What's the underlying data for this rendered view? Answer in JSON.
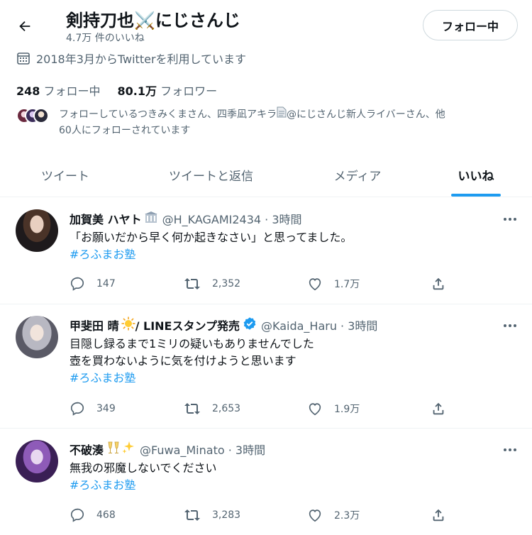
{
  "header": {
    "title": "剣持刀也⚔️にじさんじ",
    "likes_count": "4.7万 件のいいね",
    "follow_button": "フォロー中"
  },
  "profile": {
    "joined": "2018年3月からTwitterを利用しています",
    "following_count": "248",
    "following_label": "フォロー中",
    "followers_count": "80.1万",
    "followers_label": "フォロワー",
    "known_followers_1": "フォローしているつきみくまさん、四季凪アキラ",
    "known_followers_2": "@にじさんじ新人ライバーさん、他",
    "known_followers_3": "60人にフォローされています"
  },
  "tabs": [
    "ツイート",
    "ツイートと返信",
    "メディア",
    "いいね"
  ],
  "tweets": [
    {
      "name": "加賀美 ハヤト",
      "handle_time": "@H_KAGAMI2434 · 3時間",
      "line1": "「お願いだから早く何か起きなさい」と思ってました。",
      "line2": "",
      "hashtag": "#ろふまお塾",
      "replies": "147",
      "retweets": "2,352",
      "likes": "1.7万"
    },
    {
      "name": "甲斐田 晴",
      "name_suffix": " / LINEスタンプ発売",
      "handle_time": "@Kaida_Haru · 3時間",
      "line1": "目隠し録るまで1ミリの疑いもありませんでした",
      "line2": "壺を買わないように気を付けようと思います",
      "hashtag": "#ろふまお塾",
      "replies": "349",
      "retweets": "2,653",
      "likes": "1.9万"
    },
    {
      "name": "不破湊",
      "handle_time": "@Fuwa_Minato · 3時間",
      "line1": "無我の邪魔しないでください",
      "line2": "",
      "hashtag": "#ろふまお塾",
      "replies": "468",
      "retweets": "3,283",
      "likes": "2.3万"
    }
  ],
  "colors": {
    "accent": "#1d9bf0",
    "text": "#0f1419",
    "secondary": "#536471",
    "verified": "#1d9bf0"
  },
  "icons": [
    "back-arrow-icon",
    "calendar-icon",
    "more-icon",
    "reply-icon",
    "retweet-icon",
    "like-icon",
    "share-icon",
    "verified-icon"
  ]
}
